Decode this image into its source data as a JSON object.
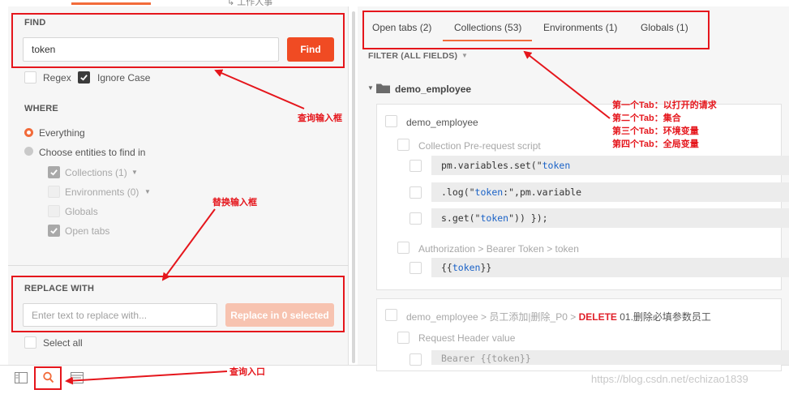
{
  "top": {
    "truncated_tab": "↳ 工作人事"
  },
  "find": {
    "title": "FIND",
    "input_value": "token",
    "find_button": "Find",
    "regex_label": "Regex",
    "ignore_case_label": "Ignore Case"
  },
  "where": {
    "title": "WHERE",
    "everything_label": "Everything",
    "choose_label": "Choose entities to find in",
    "entities": [
      {
        "label": "Collections (1)",
        "has_caret": true
      },
      {
        "label": "Environments (0)",
        "has_caret": true
      },
      {
        "label": "Globals",
        "has_caret": false
      },
      {
        "label": "Open tabs",
        "has_caret": false
      }
    ]
  },
  "replace": {
    "title": "REPLACE WITH",
    "placeholder": "Enter text to replace with...",
    "button": "Replace in 0 selected",
    "select_all_label": "Select all"
  },
  "tabs": [
    {
      "label": "Open tabs (2)"
    },
    {
      "label": "Collections (53)"
    },
    {
      "label": "Environments (1)"
    },
    {
      "label": "Globals (1)"
    }
  ],
  "filter_label": "FILTER (ALL FIELDS)",
  "collection": {
    "name": "demo_employee",
    "card1": {
      "title": "demo_employee",
      "section1": "Collection Pre-request script",
      "rows": [
        {
          "pre": "pm.variables.set(\"",
          "hl": "token",
          "post": ""
        },
        {
          "pre": ".log(\"",
          "hl": "token",
          "post": ":\",pm.variable"
        },
        {
          "pre": "s.get(\"",
          "hl": "token",
          "post": "\")) });"
        }
      ],
      "section2": "Authorization > Bearer Token > token",
      "auth_row": {
        "pre": "{{",
        "hl": "token",
        "post": "}}"
      }
    },
    "card2": {
      "path": "demo_employee > 员工添加|删除_P0 >",
      "method": "DELETE",
      "request": "01.删除必填参数员工",
      "section": "Request Header value",
      "row_partial": "Bearer {{token}}"
    }
  },
  "annotations": {
    "find_box": "查询输入框",
    "tabs_lines": [
      "第一个Tab：以打开的请求",
      "第二个Tab：集合",
      "第三个Tab：环境变量",
      "第四个Tab：全局变量"
    ],
    "replace_box": "替换输入框",
    "entry": "查询入口"
  },
  "watermark": "https://blog.csdn.net/echizao1839",
  "colors": {
    "accent": "#f26b3a",
    "find_button": "#f04b23",
    "annotation": "#e5161c",
    "highlight": "#1a62c7"
  }
}
